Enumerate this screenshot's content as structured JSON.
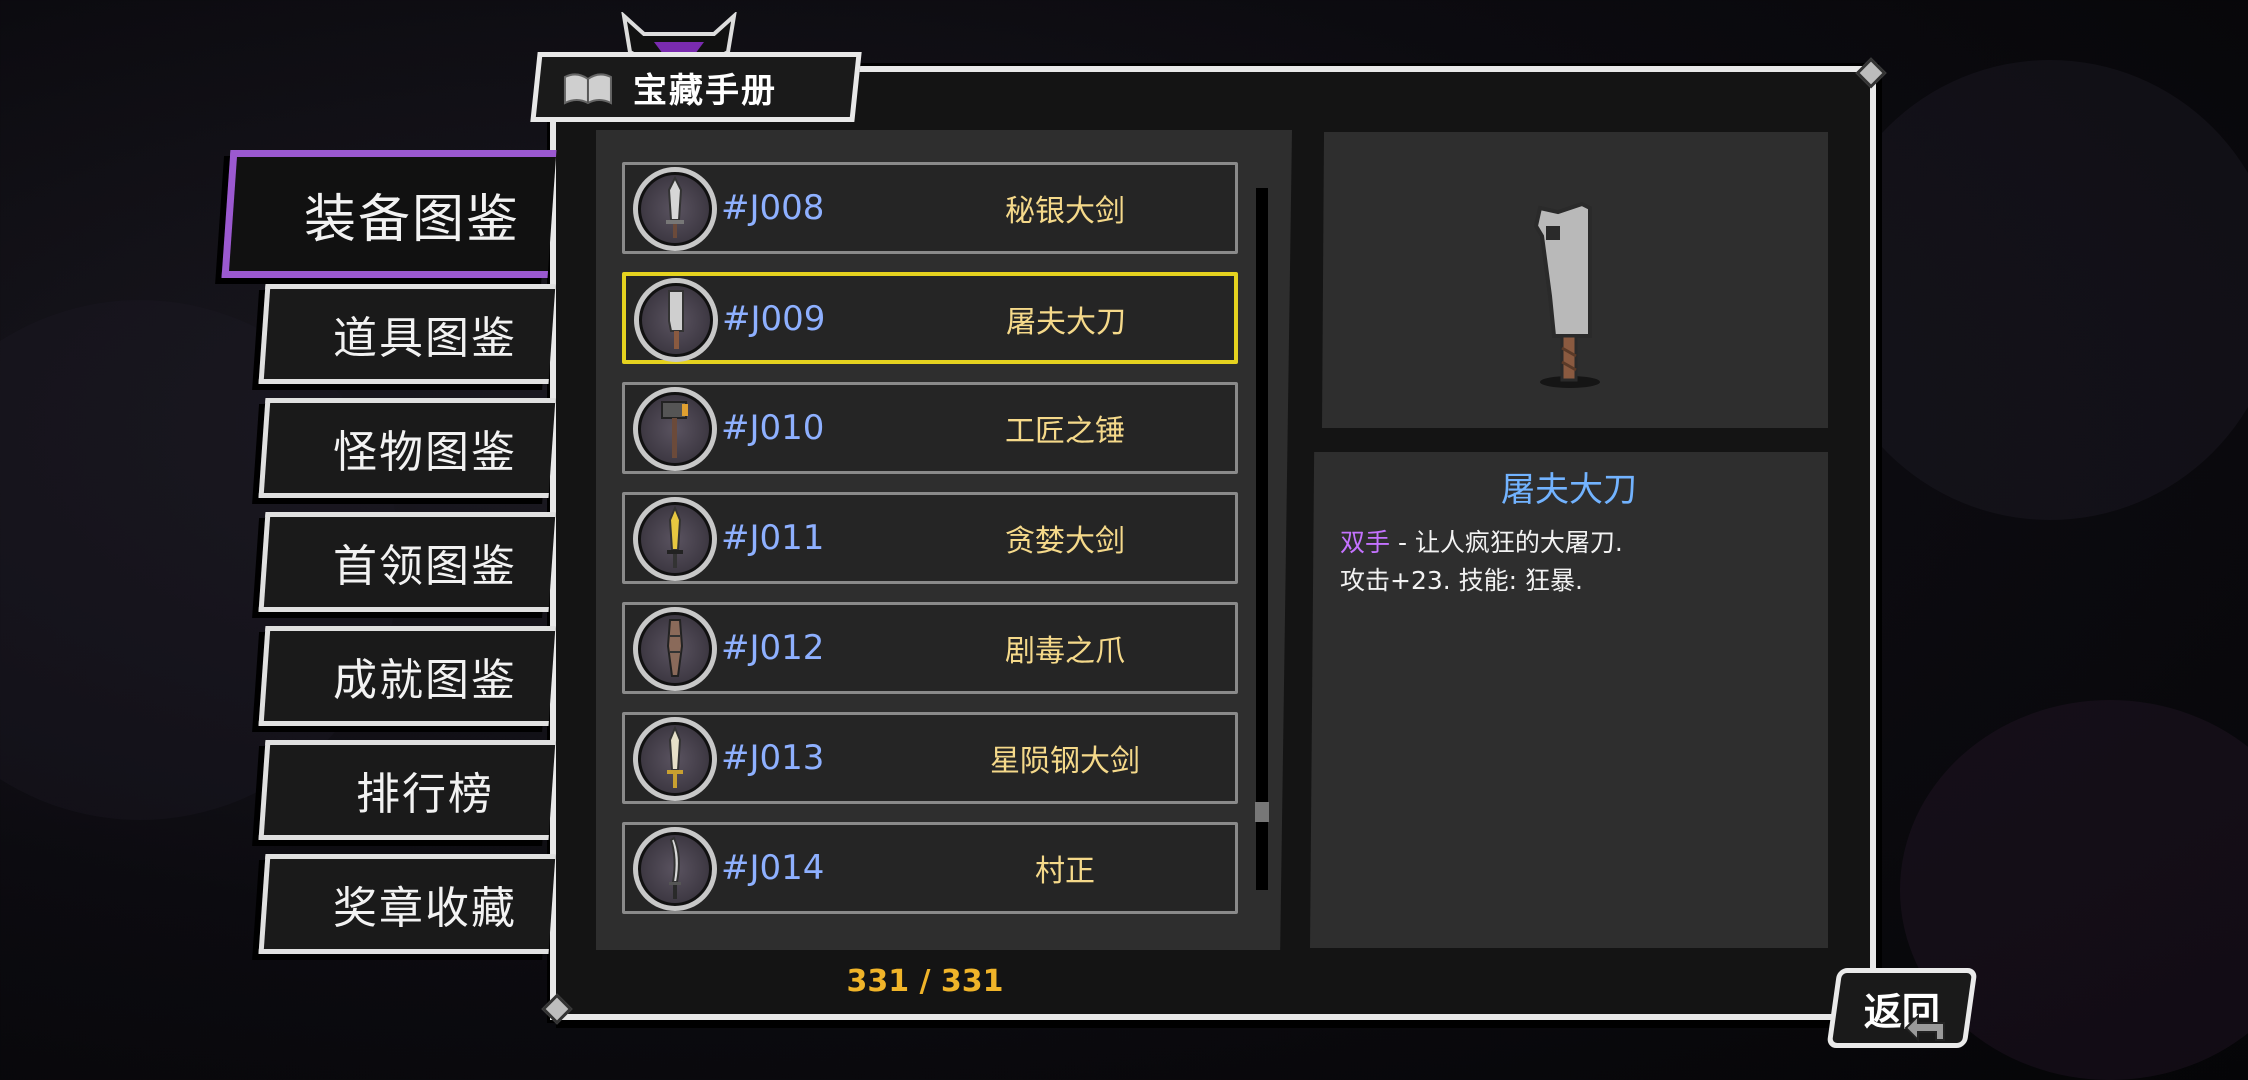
{
  "title": "宝藏手册",
  "sidebar": {
    "items": [
      {
        "label": "装备图鉴",
        "active": true
      },
      {
        "label": "道具图鉴"
      },
      {
        "label": "怪物图鉴"
      },
      {
        "label": "首领图鉴"
      },
      {
        "label": "成就图鉴"
      },
      {
        "label": "排行榜"
      },
      {
        "label": "奖章收藏"
      }
    ]
  },
  "list": {
    "rows": [
      {
        "id": "#J008",
        "name": "秘银大剑",
        "icon": "greatsword-icon"
      },
      {
        "id": "#J009",
        "name": "屠夫大刀",
        "icon": "cleaver-icon",
        "selected": true
      },
      {
        "id": "#J010",
        "name": "工匠之锤",
        "icon": "hammer-icon"
      },
      {
        "id": "#J011",
        "name": "贪婪大剑",
        "icon": "golden-sword-icon"
      },
      {
        "id": "#J012",
        "name": "剧毒之爪",
        "icon": "claw-icon"
      },
      {
        "id": "#J013",
        "name": "星陨钢大剑",
        "icon": "star-sword-icon"
      },
      {
        "id": "#J014",
        "name": "村正",
        "icon": "katana-icon"
      }
    ],
    "count": "331 / 331"
  },
  "detail": {
    "name": "屠夫大刀",
    "type_tag": "双手",
    "desc_line1": " - 让人疯狂的大屠刀.",
    "desc_line2": "攻击+23. 技能: 狂暴."
  },
  "back_label": "返回",
  "colors": {
    "accent_purple": "#9b59d0",
    "selection_yellow": "#e5d21f",
    "id_blue": "#8eb0ff",
    "name_gold": "#f5d98a",
    "title_blue": "#72b3ff",
    "count_orange": "#f0b429"
  }
}
